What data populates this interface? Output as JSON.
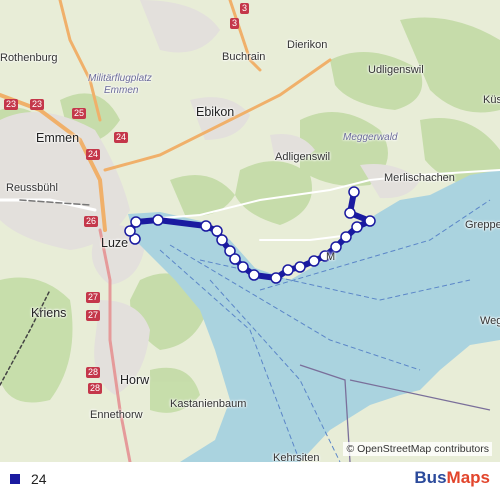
{
  "map": {
    "colors": {
      "land": "#e8edd7",
      "forest": "#c3dba6",
      "urban": "#e3e0dc",
      "water": "#aad3df",
      "route": "#1a1aa0",
      "stop_fill": "#ffffff"
    },
    "places": [
      {
        "name": "Rothenburg",
        "kind": "town"
      },
      {
        "name": "Militärflugplatz",
        "kind": "poi"
      },
      {
        "name": "Emmen",
        "kind": "poi"
      },
      {
        "name": "Emmen",
        "kind": "city"
      },
      {
        "name": "Buchrain",
        "kind": "town"
      },
      {
        "name": "Dierikon",
        "kind": "town"
      },
      {
        "name": "Udligenswil",
        "kind": "town"
      },
      {
        "name": "Küs",
        "kind": "town"
      },
      {
        "name": "Ebikon",
        "kind": "city"
      },
      {
        "name": "Adligenswil",
        "kind": "town"
      },
      {
        "name": "Meggerwald",
        "kind": "forest"
      },
      {
        "name": "Reussbühl",
        "kind": "town"
      },
      {
        "name": "Merlischachen",
        "kind": "town"
      },
      {
        "name": "Greppe",
        "kind": "town"
      },
      {
        "name": "Luze",
        "kind": "city"
      },
      {
        "name": "M",
        "kind": "town"
      },
      {
        "name": "Kriens",
        "kind": "city"
      },
      {
        "name": "Weg",
        "kind": "town"
      },
      {
        "name": "Horw",
        "kind": "city"
      },
      {
        "name": "Kastanienbaum",
        "kind": "town"
      },
      {
        "name": "Ennethorw",
        "kind": "town"
      },
      {
        "name": "Kehrsiten",
        "kind": "town"
      }
    ],
    "road_numbers": [
      "3",
      "3",
      "23",
      "23",
      "25",
      "24",
      "24",
      "26",
      "27",
      "27",
      "28",
      "28"
    ],
    "attribution": "© OpenStreetMap contributors"
  },
  "legend": {
    "route_label": "24",
    "route_color": "#1a1aa0"
  },
  "brand": {
    "part1": "Bus",
    "part2": "Maps"
  }
}
